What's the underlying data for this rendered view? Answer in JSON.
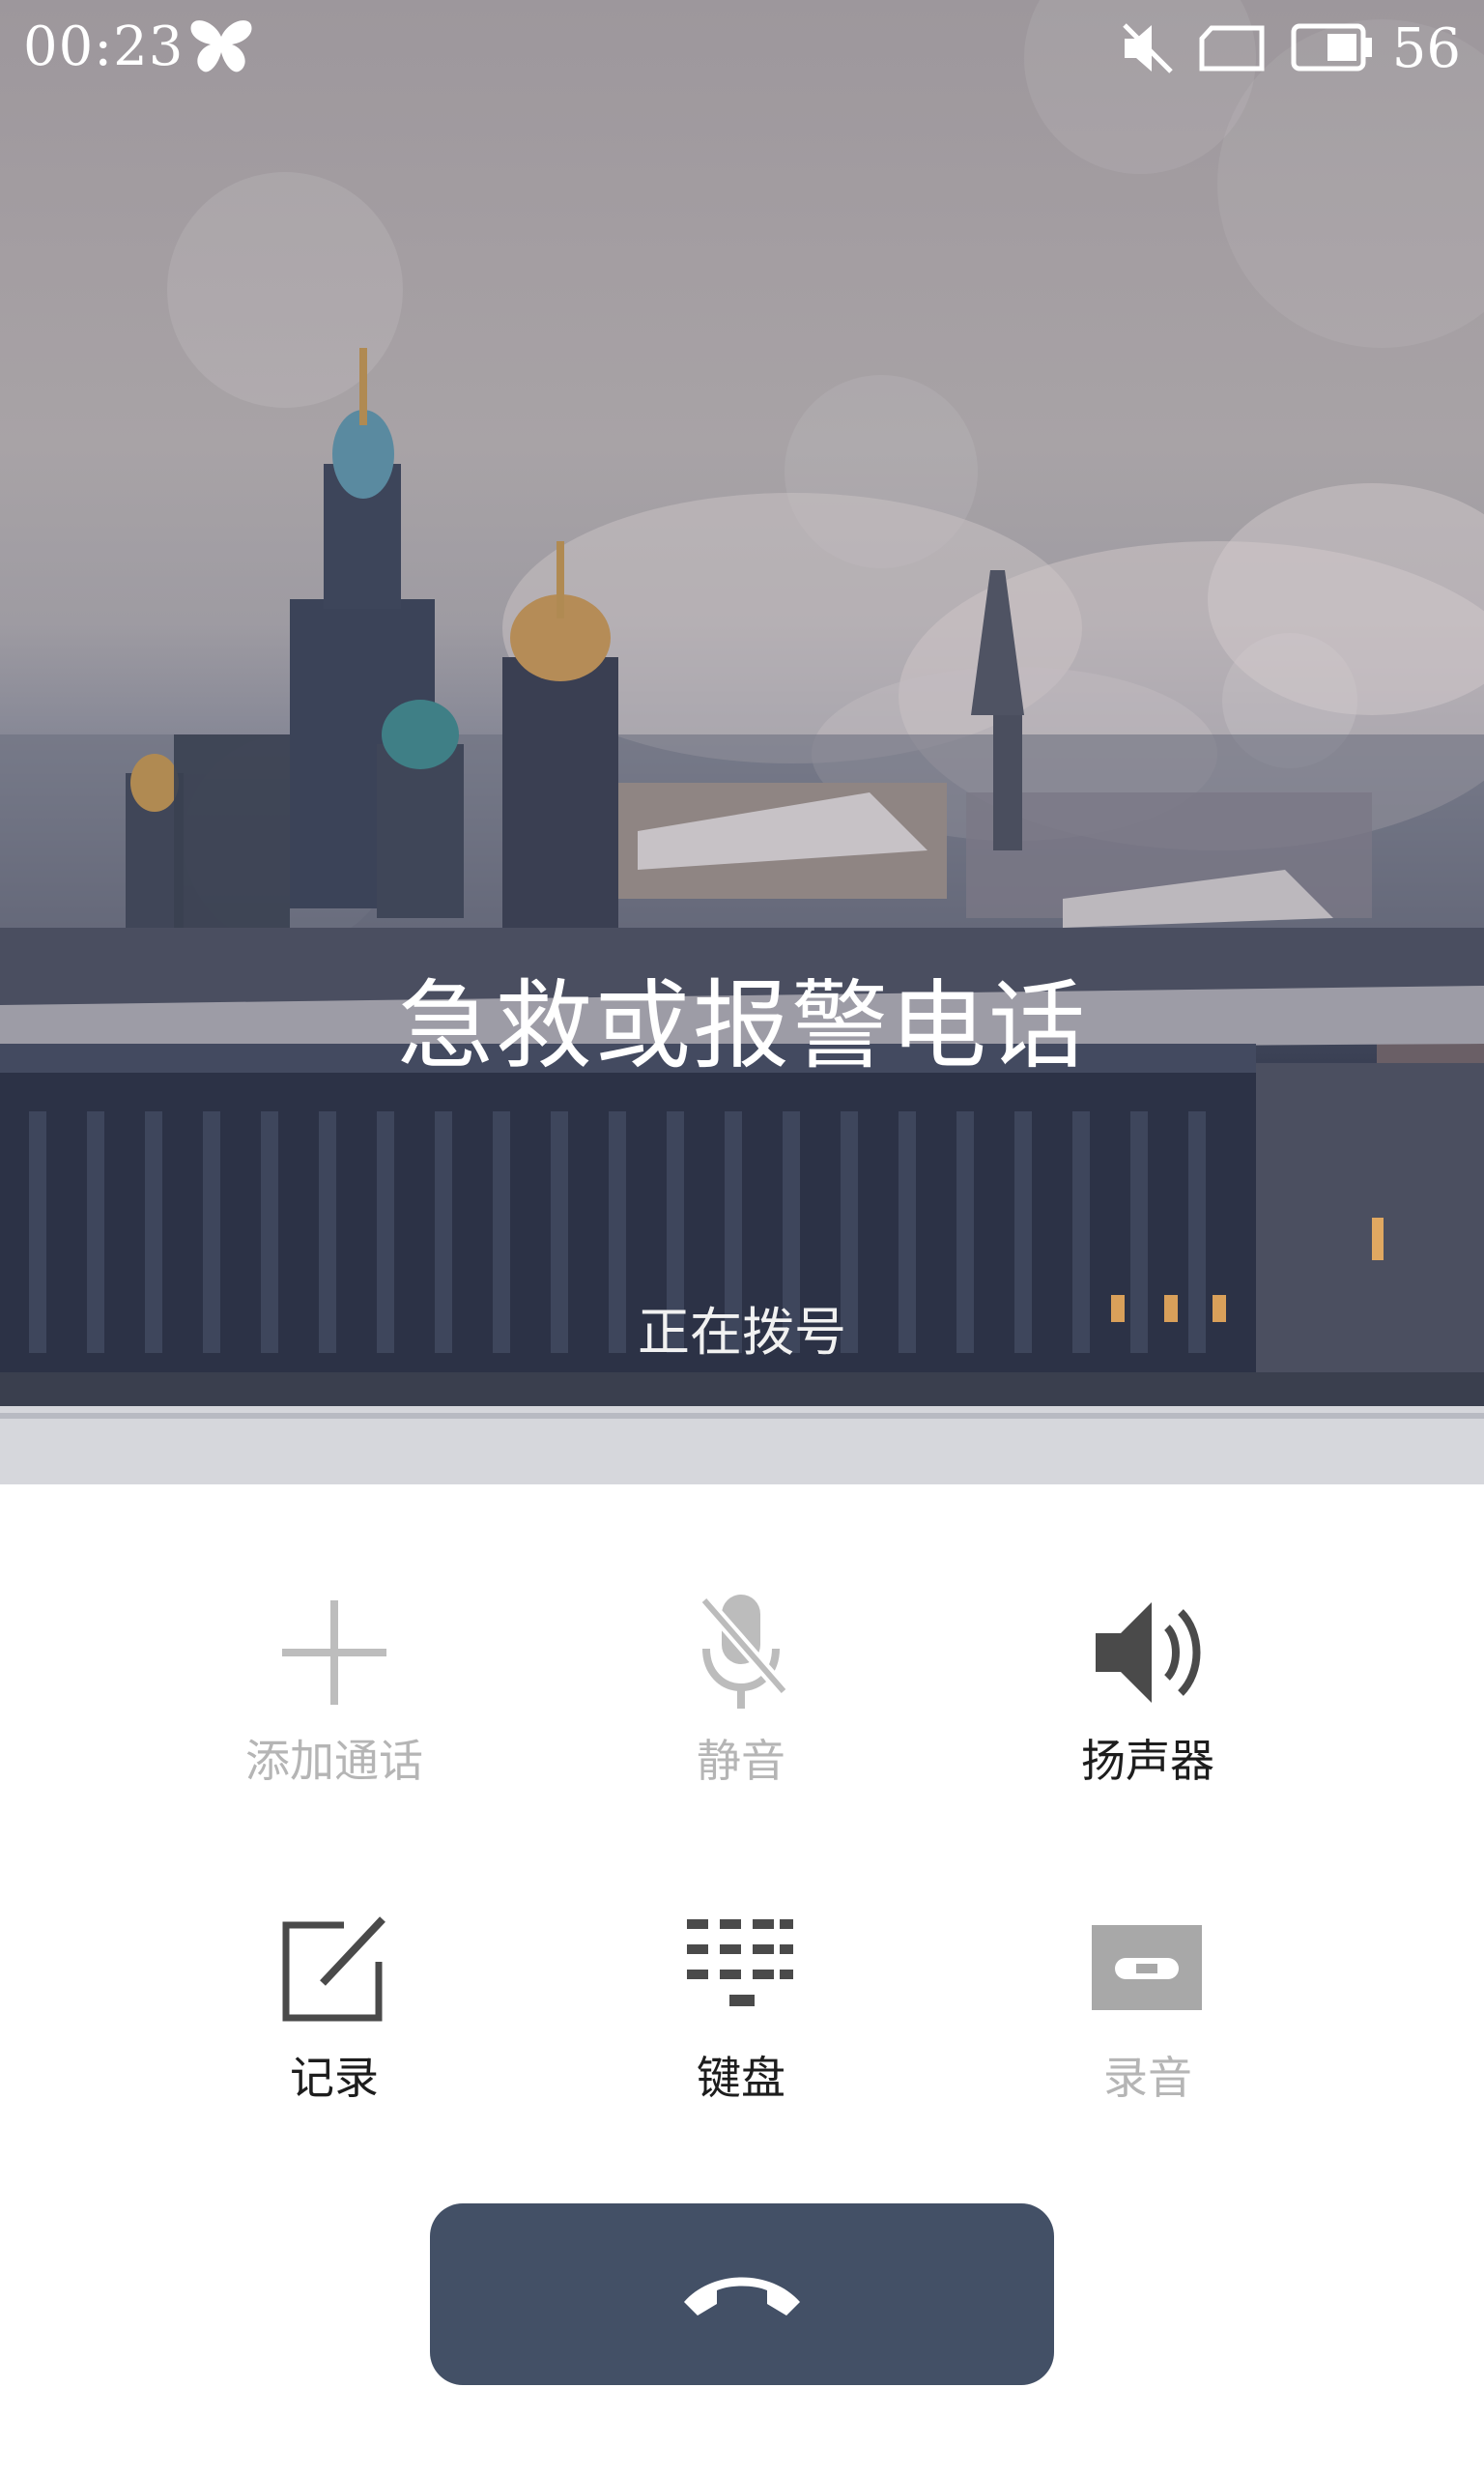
{
  "status_bar": {
    "time": "00:23",
    "battery_percent": "56",
    "icons": [
      "butterfly-icon",
      "mute-icon",
      "no-sim-icon",
      "battery-icon"
    ]
  },
  "call": {
    "caller": "急救或报警电话",
    "state": "正在拨号"
  },
  "controls": {
    "add_call": "添加通话",
    "mute": "静音",
    "speaker": "扬声器",
    "note": "记录",
    "keypad": "键盘",
    "record": "录音"
  },
  "colors": {
    "end_call_button": "#435066",
    "dim_label": "#b5b5b5",
    "active_label": "#1d1d1d"
  }
}
